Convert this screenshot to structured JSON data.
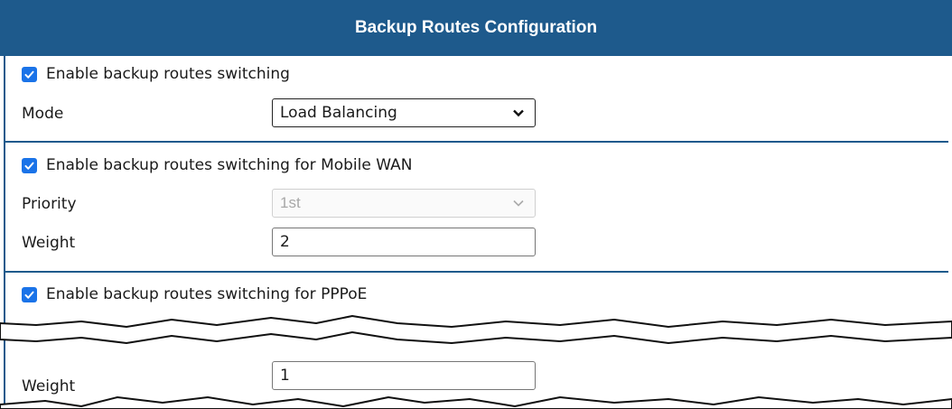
{
  "header": {
    "title": "Backup Routes Configuration"
  },
  "general": {
    "enable_label": "Enable backup routes switching",
    "mode_label": "Mode",
    "mode_value": "Load Balancing"
  },
  "mobile_wan": {
    "enable_label": "Enable backup routes switching for Mobile WAN",
    "priority_label": "Priority",
    "priority_value": "1st",
    "weight_label": "Weight",
    "weight_value": "2"
  },
  "pppoe": {
    "enable_label": "Enable backup routes switching for PPPoE",
    "weight_label": "Weight",
    "weight_value": "1"
  },
  "colors": {
    "accent": "#1e5a8c",
    "checkbox": "#1a73e8"
  },
  "icons": {
    "checkbox_checked": "check-icon",
    "select_arrow": "chevron-down-icon"
  }
}
